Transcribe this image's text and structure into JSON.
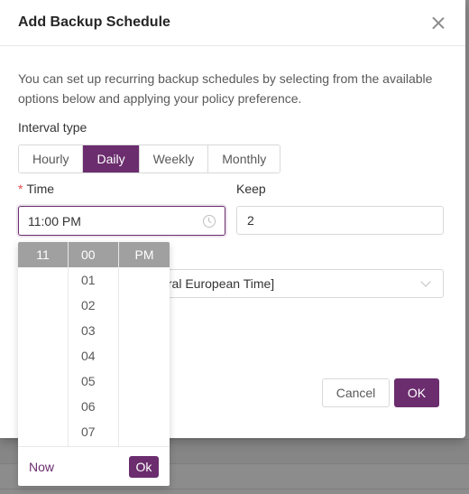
{
  "modal": {
    "title": "Add Backup Schedule",
    "description": "You can set up recurring backup schedules by selecting from the available options below and applying your policy preference.",
    "interval_label": "Interval type",
    "interval_options": [
      "Hourly",
      "Daily",
      "Weekly",
      "Monthly"
    ],
    "interval_selected": "Daily",
    "time_label": "Time",
    "time_required_mark": "*",
    "time_value": "11:00 PM",
    "keep_label": "Keep",
    "keep_value": "2",
    "timezone_value": "tral European Time]",
    "cancel_label": "Cancel",
    "ok_label": "OK"
  },
  "time_picker": {
    "hours": [
      "11"
    ],
    "minutes": [
      "00",
      "01",
      "02",
      "03",
      "04",
      "05",
      "06",
      "07"
    ],
    "period": [
      "PM"
    ],
    "selected_hour": "11",
    "selected_minute": "00",
    "selected_period": "PM",
    "now_label": "Now",
    "ok_label": "Ok"
  },
  "colors": {
    "accent": "#6b2d6e",
    "selected_cell": "#a0a0a0",
    "required": "#e5484d"
  },
  "icons": {
    "close": "close-icon",
    "clock": "clock-icon",
    "dropdown": "chevron-down-icon"
  }
}
